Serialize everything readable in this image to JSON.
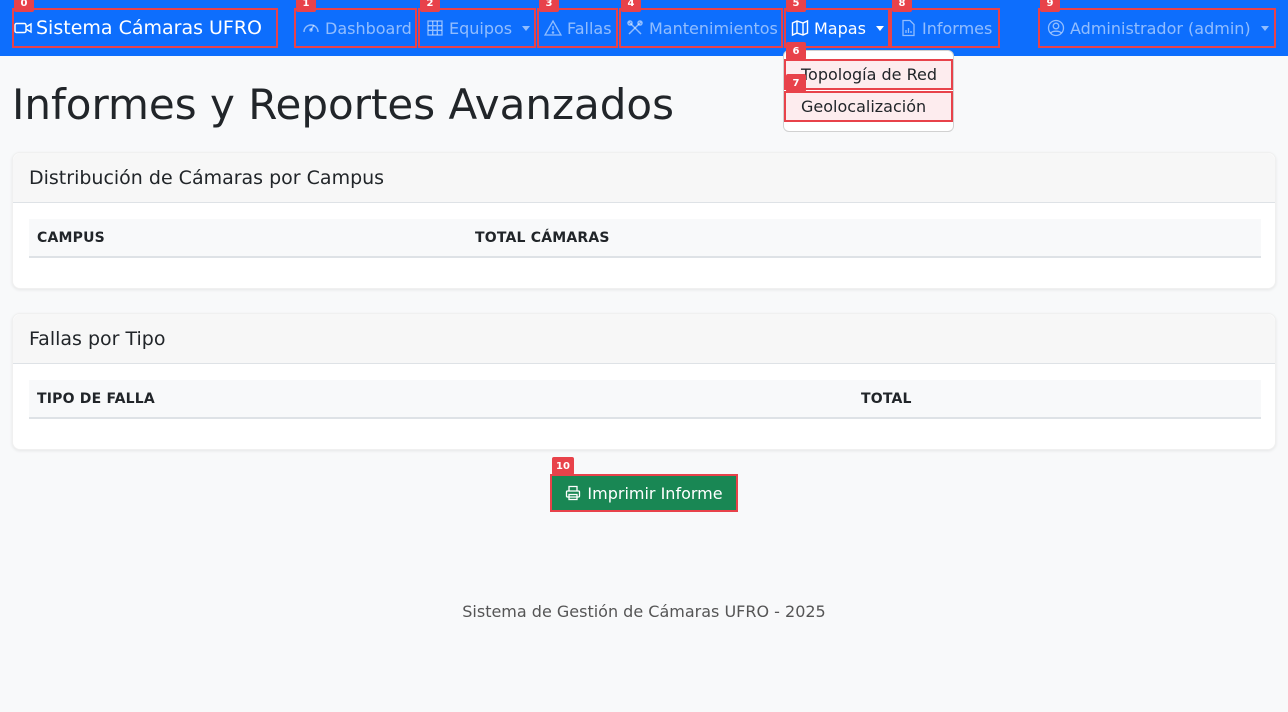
{
  "navbar": {
    "brand": {
      "label": "Sistema Cámaras UFRO",
      "icon": "video-camera-icon"
    },
    "items": [
      {
        "label": "Dashboard",
        "icon": "speedometer-icon",
        "badge": "1"
      },
      {
        "label": "Equipos",
        "icon": "grid-icon",
        "badge": "2"
      },
      {
        "label": "Fallas",
        "icon": "warning-icon",
        "badge": "3"
      },
      {
        "label": "Mantenimientos",
        "icon": "tools-icon",
        "badge": "4"
      },
      {
        "label": "Mapas",
        "icon": "map-icon",
        "badge": "5"
      },
      {
        "label": "Informes",
        "icon": "report-icon",
        "badge": "8"
      }
    ],
    "user": {
      "label": "Administrador (admin)",
      "icon": "user-circle-icon",
      "badge": "9"
    },
    "brand_badge": "0"
  },
  "dropdown": {
    "items": [
      {
        "label": "Topología de Red",
        "badge": "6"
      },
      {
        "label": "Geolocalización",
        "badge": "7"
      }
    ]
  },
  "page": {
    "title": "Informes y Reportes Avanzados"
  },
  "cards": [
    {
      "title": "Distribución de Cámaras por Campus",
      "columns": [
        "CAMPUS",
        "TOTAL CÁMARAS"
      ]
    },
    {
      "title": "Fallas por Tipo",
      "columns": [
        "TIPO DE FALLA",
        "TOTAL"
      ]
    }
  ],
  "print_button": {
    "label": "Imprimir Informe",
    "badge": "10",
    "icon": "printer-icon"
  },
  "footer": {
    "text": "Sistema de Gestión de Cámaras UFRO - 2025"
  },
  "colors": {
    "navbar": "#0d6efd",
    "button": "#198754",
    "highlight": "#e8424a"
  }
}
